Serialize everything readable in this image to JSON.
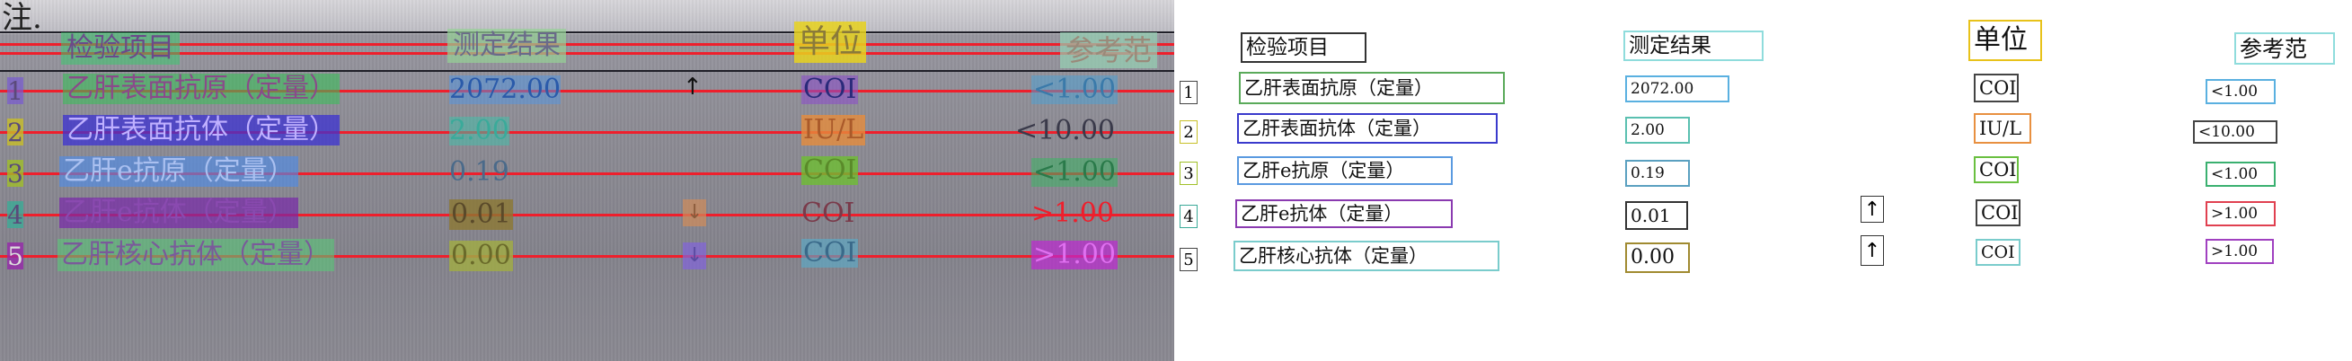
{
  "photo": {
    "corner_text": "注.",
    "headers": [
      "检验项目",
      "测定结果",
      "单位",
      "参考范"
    ],
    "rows": [
      {
        "num": "1",
        "item": "乙肝表面抗原（定量）",
        "result": "2072.00",
        "flag": "↑",
        "unit": "COI",
        "ref": "<1.00"
      },
      {
        "num": "2",
        "item": "乙肝表面抗体（定量）",
        "result": "2.00",
        "flag": "",
        "unit": "IU/L",
        "ref": "<10.00"
      },
      {
        "num": "3",
        "item": "乙肝e抗原（定量）",
        "result": "0.19",
        "flag": "",
        "unit": "COI",
        "ref": "<1.00"
      },
      {
        "num": "4",
        "item": "乙肝e抗体（定量）",
        "result": "0.01",
        "flag": "↓",
        "unit": "COI",
        "ref": ">1.00"
      },
      {
        "num": "5",
        "item": "乙肝核心抗体（定量）",
        "result": "0.00",
        "flag": "↓",
        "unit": "COI",
        "ref": ">1.00"
      }
    ]
  },
  "render": {
    "headers": [
      "检验项目",
      "测定结果",
      "单位",
      "参考范"
    ],
    "rows": [
      {
        "num": "1",
        "item": "乙肝表面抗原（定量）",
        "result": "2072.00",
        "flag": "",
        "unit": "COI",
        "ref": "<1.00"
      },
      {
        "num": "2",
        "item": "乙肝表面抗体（定量）",
        "result": "2.00",
        "flag": "",
        "unit": "IU/L",
        "ref": "<10.00"
      },
      {
        "num": "3",
        "item": "乙肝e抗原（定量）",
        "result": "0.19",
        "flag": "",
        "unit": "COI",
        "ref": "<1.00"
      },
      {
        "num": "4",
        "item": "乙肝e抗体（定量）",
        "result": "0.01",
        "flag": "↑",
        "unit": "COI",
        "ref": ">1.00"
      },
      {
        "num": "5",
        "item": "乙肝核心抗体（定量）",
        "result": "0.00",
        "flag": "↑",
        "unit": "COI",
        "ref": ">1.00"
      }
    ]
  },
  "colors": {
    "red_line": "#ee1f2c",
    "item_box": "#3bd08a",
    "result_box": "#6cc0f0",
    "unit_box": "#e8e21a",
    "ref_box": "#8fd0c0"
  }
}
